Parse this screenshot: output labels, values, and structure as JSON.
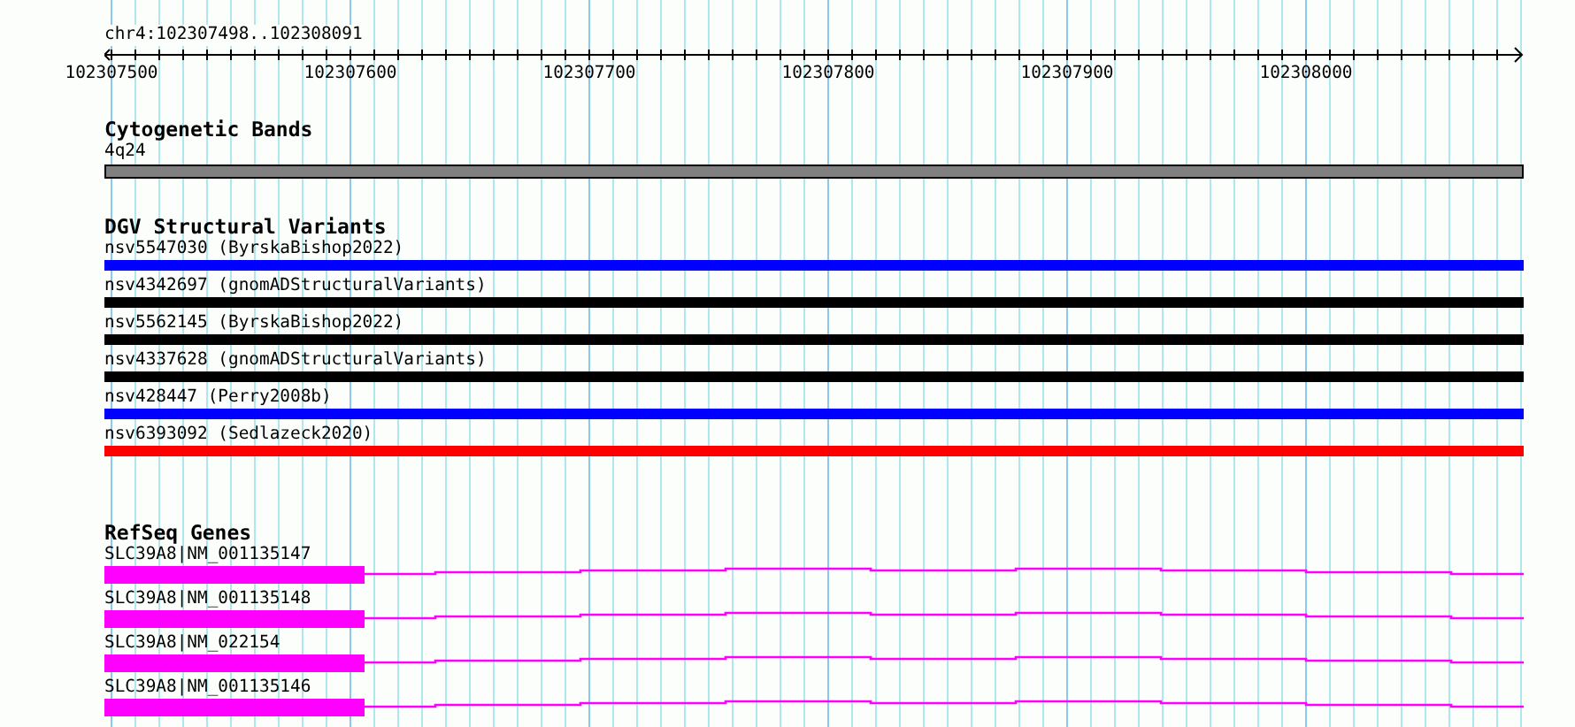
{
  "location": "chr4:102307498..102308091",
  "ruler": {
    "ticks": [
      "102307500",
      "102307600",
      "102307700",
      "102307800",
      "102307900",
      "102308000"
    ]
  },
  "tracks": [
    {
      "title": "Cytogenetic Bands",
      "kind": "band",
      "features": [
        {
          "label": "4q24"
        }
      ]
    },
    {
      "title": "DGV Structural Variants",
      "kind": "variant",
      "features": [
        {
          "label": "nsv5547030 (ByrskaBishop2022)",
          "color": "#0000ff"
        },
        {
          "label": "nsv4342697 (gnomADStructuralVariants)",
          "color": "#000000"
        },
        {
          "label": "nsv5562145 (ByrskaBishop2022)",
          "color": "#000000"
        },
        {
          "label": "nsv4337628 (gnomADStructuralVariants)",
          "color": "#000000"
        },
        {
          "label": "nsv428447 (Perry2008b)",
          "color": "#0000ff"
        },
        {
          "label": "nsv6393092 (Sedlazeck2020)",
          "color": "#ff0000"
        }
      ]
    },
    {
      "title": "RefSeq Genes",
      "kind": "gene",
      "features": [
        {
          "label": "SLC39A8|NM_001135147"
        },
        {
          "label": "SLC39A8|NM_001135148"
        },
        {
          "label": "SLC39A8|NM_022154"
        },
        {
          "label": "SLC39A8|NM_001135146"
        }
      ]
    }
  ]
}
